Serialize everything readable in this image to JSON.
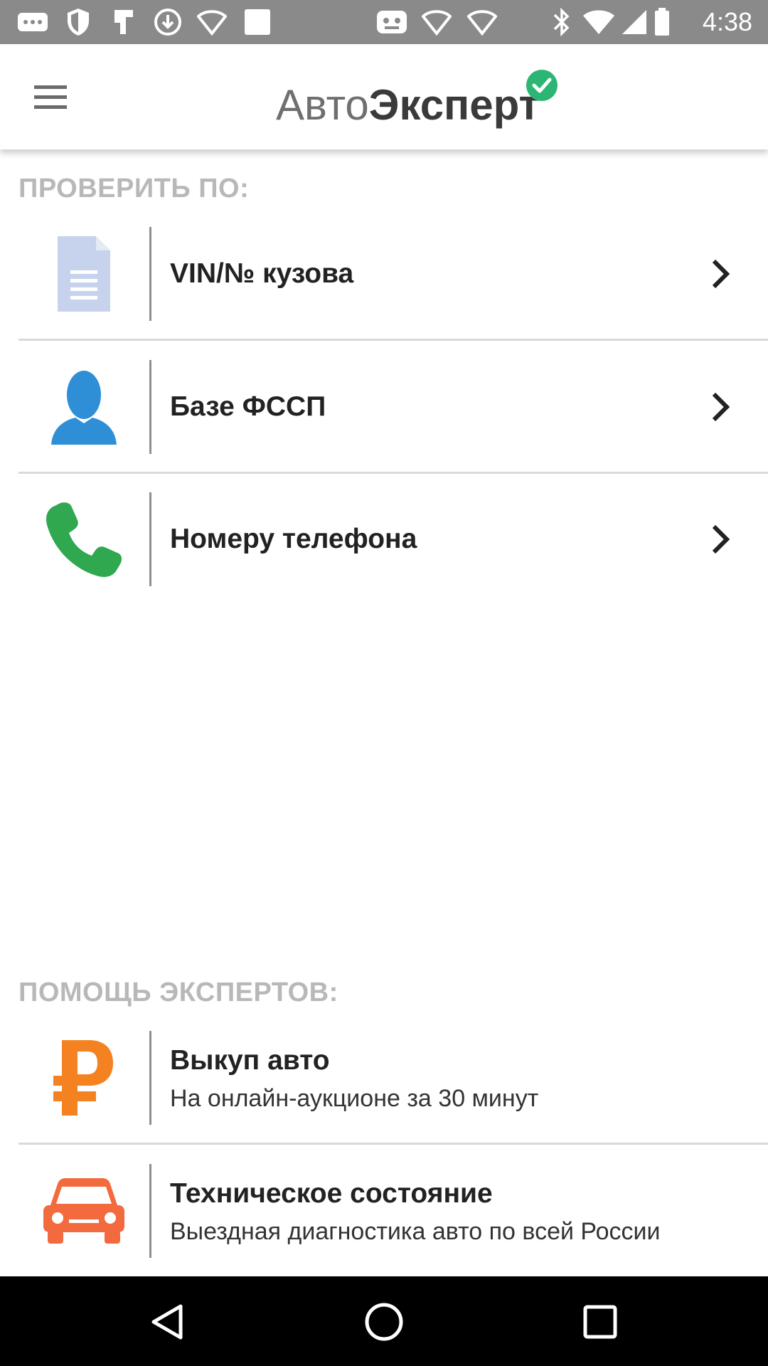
{
  "status_bar": {
    "time": "4:38",
    "icons": [
      "more-dots-icon",
      "shield-icon",
      "flash-icon",
      "download-icon",
      "wifi-icon",
      "blank-square-icon",
      "game-icon",
      "wifi-icon",
      "wifi-icon",
      "bluetooth-icon",
      "wifi-signal-icon",
      "signal-icon",
      "battery-icon"
    ]
  },
  "app_bar": {
    "title_light": "Авто",
    "title_bold": "Эксперт",
    "menu_icon": "hamburger-menu-icon",
    "verified_icon": "check-badge-icon"
  },
  "check_section": {
    "title": "ПРОВЕРИТЬ ПО:",
    "items": [
      {
        "label": "VIN/№ кузова",
        "icon": "document-icon"
      },
      {
        "label": "Базе ФССП",
        "icon": "person-icon"
      },
      {
        "label": "Номеру телефона",
        "icon": "phone-icon"
      }
    ]
  },
  "experts_section": {
    "title": "ПОМОЩЬ ЭКСПЕРТОВ:",
    "items": [
      {
        "label": "Выкуп авто",
        "subtitle": "На онлайн-аукционе за 30 минут",
        "icon": "ruble-icon"
      },
      {
        "label": "Техническое состояние",
        "subtitle": "Выездная диагностика авто по всей России",
        "icon": "car-icon"
      }
    ]
  },
  "colors": {
    "accent_green": "#2bb673",
    "person_blue": "#2f8fd6",
    "phone_green": "#2fa84f",
    "ruble_orange": "#f58220",
    "car_orange": "#f26a3d",
    "doc_blue": "#c7d3ec"
  },
  "nav_bar": {
    "buttons": [
      "back-icon",
      "home-icon",
      "recents-icon"
    ]
  }
}
